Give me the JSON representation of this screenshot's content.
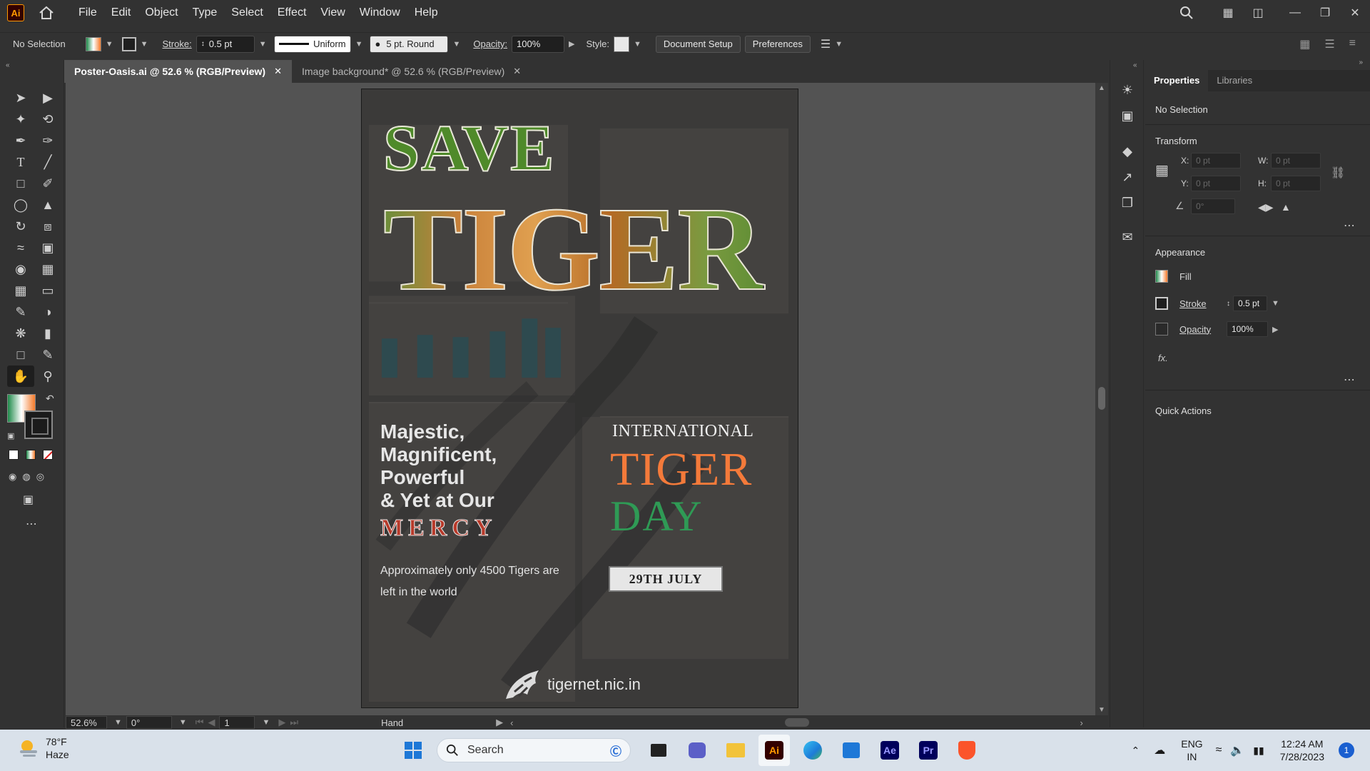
{
  "app": {
    "logo": "Ai"
  },
  "menu": [
    "File",
    "Edit",
    "Object",
    "Type",
    "Select",
    "Effect",
    "View",
    "Window",
    "Help"
  ],
  "control": {
    "selection": "No Selection",
    "stroke_label": "Stroke:",
    "stroke_value": "0.5 pt",
    "stroke_profile": "Uniform",
    "brush": "5 pt. Round",
    "opacity_label": "Opacity:",
    "opacity_value": "100%",
    "style_label": "Style:",
    "document_setup": "Document Setup",
    "preferences": "Preferences"
  },
  "tabs": [
    {
      "label": "Poster-Oasis.ai @ 52.6 % (RGB/Preview)",
      "active": true
    },
    {
      "label": "Image background* @ 52.6 % (RGB/Preview)",
      "active": false
    }
  ],
  "poster": {
    "save": "SAVE",
    "tiger_big": "TIGER",
    "tagline": [
      "Majestic,",
      "Magnificent,",
      "Powerful",
      "& Yet at Our"
    ],
    "mercy": "MERCY",
    "approx": "Approximately only 4500 Tigers are left in the world",
    "international": "INTERNATIONAL",
    "tiger_orange": "TIGER",
    "day": "DAY",
    "date": "29TH JULY",
    "site": "tigernet.nic.in"
  },
  "status": {
    "zoom": "52.6%",
    "rotation": "0°",
    "artboard": "1",
    "tool": "Hand"
  },
  "properties": {
    "tab_properties": "Properties",
    "tab_libraries": "Libraries",
    "selection": "No Selection",
    "transform_title": "Transform",
    "x_label": "X:",
    "y_label": "Y:",
    "w_label": "W:",
    "h_label": "H:",
    "x_value": "0 pt",
    "y_value": "0 pt",
    "w_value": "0 pt",
    "h_value": "0 pt",
    "angle_value": "0°",
    "appearance_title": "Appearance",
    "fill_label": "Fill",
    "stroke_label": "Stroke",
    "stroke_value": "0.5 pt",
    "opacity_label": "Opacity",
    "opacity_value": "100%",
    "fx_label": "fx.",
    "quick_actions": "Quick Actions"
  },
  "taskbar": {
    "temp": "78°F",
    "weather": "Haze",
    "search_placeholder": "Search",
    "apps": [
      "Ai",
      "Ae",
      "Pr"
    ],
    "lang": "ENG",
    "region": "IN",
    "time": "12:24 AM",
    "date": "7/28/2023",
    "notifications": "1"
  }
}
